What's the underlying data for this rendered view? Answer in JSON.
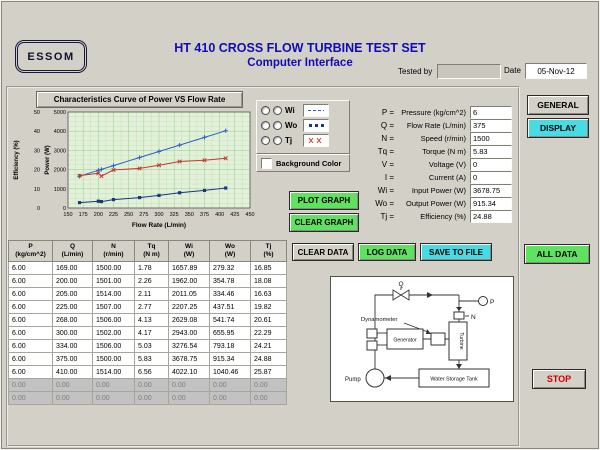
{
  "window": {
    "logo": "ESSOM",
    "title_line1": "HT 410  CROSS FLOW TURBINE TEST SET",
    "title_line2": "Computer Interface",
    "tested_by_label": "Tested by",
    "tested_by_value": "",
    "date_label": "Date",
    "date_value": "05-Nov-12"
  },
  "colors": {
    "title_blue": "#0e0eb4",
    "button_green": "#5fe25f",
    "button_cyan": "#49dbe4",
    "stop_red": "#d40000",
    "plot_background_green": "#e4f1da"
  },
  "buttons": {
    "general": "GENERAL",
    "display": "DISPLAY",
    "all_data": "ALL DATA",
    "stop": "STOP",
    "plot_graph": "PLOT GRAPH",
    "clear_graph": "CLEAR GRAPH",
    "clear_data": "CLEAR DATA",
    "log_data": "LOG DATA",
    "save_to_file": "SAVE TO FILE"
  },
  "legend": {
    "series": [
      {
        "label": "Wi"
      },
      {
        "label": "Wo"
      },
      {
        "label": "Tj"
      }
    ],
    "background_color_label": "Background Color"
  },
  "chart_data": {
    "type": "line",
    "title": "Characteristics Curve of Power VS Flow Rate",
    "xlabel": "Flow Rate (L/min)",
    "ylabel_left": "Efficiency (%)",
    "ylabel_right": "Power (W)",
    "x_range": [
      150,
      450
    ],
    "x_ticks": [
      150,
      175,
      200,
      225,
      250,
      275,
      300,
      325,
      350,
      375,
      400,
      425,
      450
    ],
    "power_range": [
      0,
      5000
    ],
    "power_ticks": [
      0,
      1000,
      2000,
      3000,
      4000,
      5000
    ],
    "eff_range": [
      0,
      50
    ],
    "eff_ticks": [
      0,
      10,
      20,
      30,
      40,
      50
    ],
    "grid": true,
    "plot_bg": "#e4f1da",
    "x": [
      169,
      200,
      205,
      225,
      268,
      300,
      334,
      375,
      410
    ],
    "series": [
      {
        "name": "Wi",
        "axis": "power",
        "marker": "plus",
        "color": "#2f5ec4",
        "values": [
          1657.89,
          1962.0,
          2011.05,
          2207.25,
          2629.08,
          2943.0,
          3276.54,
          3678.75,
          4022.1
        ]
      },
      {
        "name": "Wo",
        "axis": "power",
        "marker": "square",
        "color": "#16387c",
        "values": [
          279.32,
          354.78,
          334.46,
          437.51,
          541.74,
          655.95,
          793.18,
          915.34,
          1040.46
        ]
      },
      {
        "name": "Tj",
        "axis": "eff",
        "marker": "x",
        "color": "#c23b2e",
        "values": [
          16.85,
          18.08,
          16.63,
          19.82,
          20.61,
          22.29,
          24.21,
          24.88,
          25.87
        ]
      }
    ]
  },
  "params": {
    "rows": [
      {
        "sym": "P =",
        "desc": "Pressure (kg/cm^2)",
        "value": "6"
      },
      {
        "sym": "Q =",
        "desc": "Flow Rate (L/min)",
        "value": "375"
      },
      {
        "sym": "N =",
        "desc": "Speed (r/min)",
        "value": "1500"
      },
      {
        "sym": "Tq =",
        "desc": "Torque (N m)",
        "value": "5.83"
      },
      {
        "sym": "V =",
        "desc": "Voltage (V)",
        "value": "0"
      },
      {
        "sym": "I =",
        "desc": "Current (A)",
        "value": "0"
      },
      {
        "sym": "Wi =",
        "desc": "Input Power (W)",
        "value": "3678.75"
      },
      {
        "sym": "Wo =",
        "desc": "Output Power (W)",
        "value": "915.34"
      },
      {
        "sym": "Tj =",
        "desc": "Efficiency (%)",
        "value": "24.88"
      }
    ]
  },
  "table": {
    "headers": [
      [
        "P",
        "(kg/cm^2)"
      ],
      [
        "Q",
        "(L/min)"
      ],
      [
        "N",
        "(r/min)"
      ],
      [
        "Tq",
        "(N m)"
      ],
      [
        "Wi",
        "(W)"
      ],
      [
        "Wo",
        "(W)"
      ],
      [
        "Tj",
        "(%)"
      ]
    ],
    "rows": [
      [
        "6.00",
        "169.00",
        "1500.00",
        "1.78",
        "1657.89",
        "279.32",
        "16.85"
      ],
      [
        "6.00",
        "200.00",
        "1501.00",
        "2.26",
        "1962.00",
        "354.78",
        "18.08"
      ],
      [
        "6.00",
        "205.00",
        "1514.00",
        "2.11",
        "2011.05",
        "334.46",
        "16.63"
      ],
      [
        "6.00",
        "225.00",
        "1507.00",
        "2.77",
        "2207.25",
        "437.51",
        "19.82"
      ],
      [
        "6.00",
        "268.00",
        "1506.00",
        "4.13",
        "2629.08",
        "541.74",
        "20.61"
      ],
      [
        "6.00",
        "300.00",
        "1502.00",
        "4.17",
        "2943.00",
        "655.95",
        "22.29"
      ],
      [
        "6.00",
        "334.00",
        "1506.00",
        "5.03",
        "3276.54",
        "793.18",
        "24.21"
      ],
      [
        "6.00",
        "375.00",
        "1500.00",
        "5.83",
        "3678.75",
        "915.34",
        "24.88"
      ],
      [
        "6.00",
        "410.00",
        "1514.00",
        "6.56",
        "4022.10",
        "1040.46",
        "25.87"
      ]
    ],
    "empty_rows": [
      [
        "0.00",
        "0.00",
        "0.00",
        "0.00",
        "0.00",
        "0.00",
        "0.00"
      ],
      [
        "0.00",
        "0.00",
        "0.00",
        "0.00",
        "0.00",
        "0.00",
        "0.00"
      ]
    ]
  },
  "diagram": {
    "q": "Q",
    "dynamometer": "Dynamometer",
    "n": "N",
    "p": "P",
    "generator": "Generator",
    "turbine": "Turbine",
    "pump": "Pump",
    "tank": "Water Storage Tank"
  }
}
